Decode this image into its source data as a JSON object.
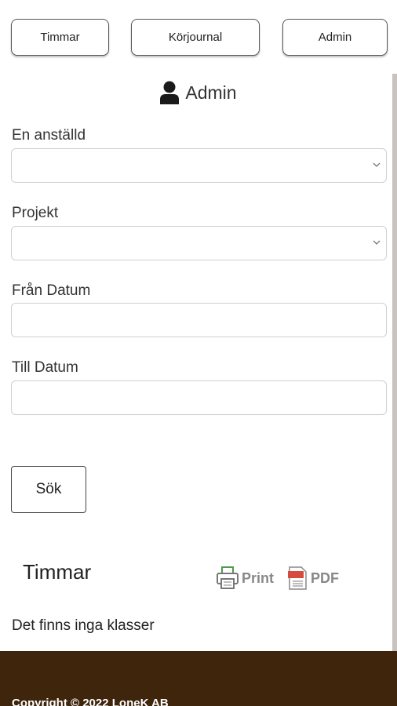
{
  "nav": {
    "timmar": "Timmar",
    "korjournal": "Körjournal",
    "admin": "Admin"
  },
  "header": {
    "title": "Admin",
    "icon": "user-icon"
  },
  "form": {
    "employee_label": "En anställd",
    "employee_value": "",
    "project_label": "Projekt",
    "project_value": "",
    "from_date_label": "Från Datum",
    "from_date_value": "",
    "to_date_label": "Till Datum",
    "to_date_value": "",
    "search_button": "Sök"
  },
  "results": {
    "title": "Timmar",
    "print_label": "Print",
    "pdf_label": "PDF",
    "empty_message": "Det finns inga klasser"
  },
  "footer": {
    "copyright": "Copyright © 2022 LoneK AB"
  },
  "colors": {
    "footer_bg": "#3e250c",
    "icon_green": "#4d9a4b",
    "icon_red": "#d64b3e"
  }
}
